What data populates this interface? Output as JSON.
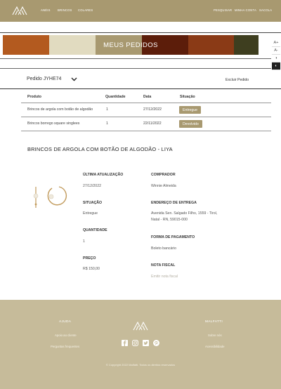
{
  "header": {
    "nav_left": [
      "ANÉIS",
      "BRINCOS",
      "COLARES"
    ],
    "nav_right": [
      "PESQUISAR",
      "MINHA CONTA",
      "SACOLA"
    ]
  },
  "banner": {
    "title": "MEUS PEDIDOS",
    "swatches": [
      "#b35a1f",
      "#e1dbc0",
      "#a89970",
      "#5c1d0a",
      "#8a3a16",
      "#3e3e1f"
    ]
  },
  "side_tools": [
    "A+",
    "A-",
    "◑",
    "◐"
  ],
  "order": {
    "selected": "Pedido JYHE74",
    "delete_label": "Excluir Pedido"
  },
  "table": {
    "headers": [
      "Produto",
      "Quantidade",
      "Data",
      "Situação"
    ],
    "rows": [
      {
        "produto": "Brincos de argola com botão de algodão",
        "quantidade": "1",
        "data": "27/12/2022",
        "situacao": "Entregue"
      },
      {
        "produto": "Brincos borrego square singlees",
        "quantidade": "1",
        "data": "22/11/2022",
        "situacao": "Devolvido"
      }
    ]
  },
  "detail": {
    "title": "BRINCOS DE ARGOLA COM BOTÃO DE ALGODÃO - LIYA",
    "ultima_atualizacao_label": "ÚLTIMA ATUALIZAÇÃO",
    "ultima_atualizacao": "27/12/2022",
    "situacao_label": "SITUAÇÃO",
    "situacao": "Entregue",
    "quantidade_label": "QUANTIDADE",
    "quantidade": "1",
    "preco_label": "PREÇO",
    "preco": "R$ 150,00",
    "comprador_label": "COMPRADOR",
    "comprador": "Winnie Almeida",
    "endereco_label": "ENDEREÇO DE ENTREGA",
    "endereco_1": "Avenida Sen. Salgado Filho, 1559 - Tirol,",
    "endereco_2": "Natal - RN, 59015-000",
    "pagamento_label": "FORMA DE PAGAMENTO",
    "pagamento": "Boleto bancário",
    "nota_label": "NOTA FISCAL",
    "nota": "Emitir nota fiscal"
  },
  "footer": {
    "ajuda_title": "AJUDA",
    "ajuda_links": [
      "Apoio ao cliente",
      "Perguntas frequentes"
    ],
    "malfatti_title": "MALFATTI",
    "malfatti_links": [
      "Sobre nós",
      "Acessibilidade"
    ],
    "social_icons": [
      "facebook-icon",
      "instagram-icon",
      "twitter-icon",
      "pinterest-icon"
    ],
    "copyright": "© Copyright 2022 Malfatti. Todos os direitos reservados"
  },
  "colors": {
    "brand": "#a89970",
    "footer": "#c6bb9a",
    "badge": "#a89970"
  }
}
